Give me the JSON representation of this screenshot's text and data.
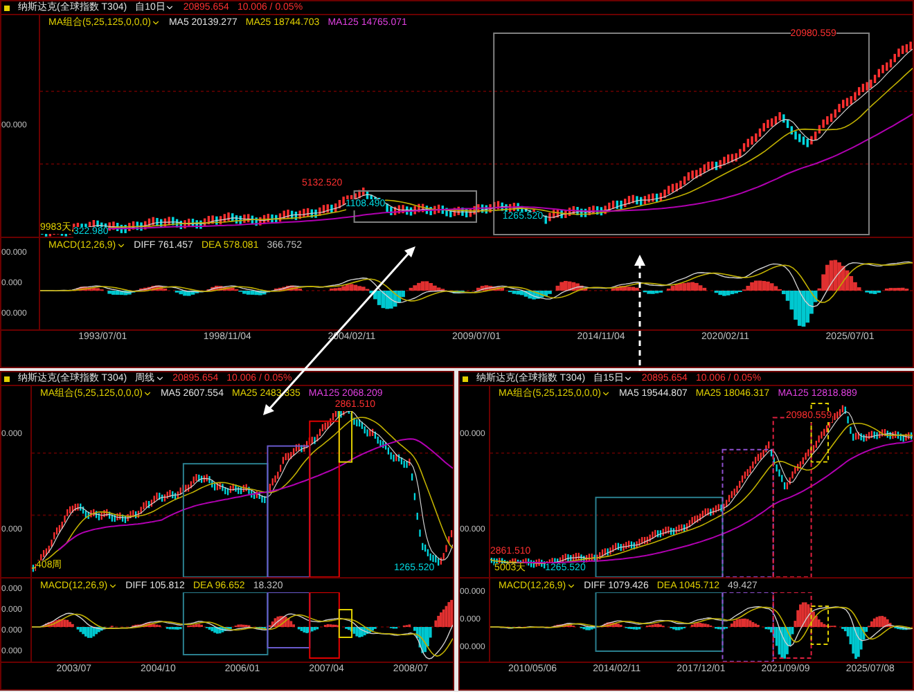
{
  "panels": [
    {
      "title": "纳斯达克(全球指数 T304)",
      "period": "自10日",
      "price": "20895.654",
      "change": "10.006 / 0.05%",
      "ma": {
        "label": "MA组合(5,25,125,0,0,0)",
        "ma5": "MA5 20139.277",
        "ma25": "MA25 18744.703",
        "ma125": "MA125 14765.071"
      },
      "price_ticks": [
        "00.000"
      ],
      "labels": [
        {
          "text": "20980.559",
          "color": "#ff3030"
        },
        {
          "text": "5132.520",
          "color": "#ff3030"
        },
        {
          "text": "1108.490",
          "color": "#00d8e0"
        },
        {
          "text": "1265.520",
          "color": "#00d8e0"
        },
        {
          "text": "9983天",
          "color": "#e0d000"
        },
        {
          "text": "322.980",
          "color": "#00d8e0"
        }
      ],
      "macd": {
        "label": "MACD(12,26,9)",
        "diff": "DIFF 761.457",
        "dea": "DEA 578.081",
        "value": "366.752"
      },
      "macd_ticks": [
        "00.000",
        "0.000",
        "00.000"
      ],
      "dates": [
        "1993/07/01",
        "1998/11/04",
        "2004/02/11",
        "2009/07/01",
        "2014/11/04",
        "2020/02/11",
        "2025/07/01"
      ]
    },
    {
      "title": "纳斯达克(全球指数 T304)",
      "period": "周线",
      "price": "20895.654",
      "change": "10.006 / 0.05%",
      "ma": {
        "label": "MA组合(5,25,125,0,0,0)",
        "ma5": "MA5 2607.554",
        "ma25": "MA25 2483.335",
        "ma125": "MA125 2068.209"
      },
      "price_ticks": [
        "0.000",
        "0.000"
      ],
      "labels": [
        {
          "text": "2861.510",
          "color": "#ff3030"
        },
        {
          "text": "1265.520",
          "color": "#00d8e0"
        },
        {
          "text": "408周",
          "color": "#e0d000"
        }
      ],
      "macd": {
        "label": "MACD(12,26,9)",
        "diff": "DIFF 105.812",
        "dea": "DEA 96.652",
        "value": "18.320"
      },
      "macd_ticks": [
        "0.000",
        "0.000",
        "0.000",
        "0.000"
      ],
      "dates": [
        "2003/07",
        "2004/10",
        "2006/01",
        "2007/04",
        "2008/07"
      ]
    },
    {
      "title": "纳斯达克(全球指数 T304)",
      "period": "自15日",
      "price": "20895.654",
      "change": "10.006 / 0.05%",
      "ma": {
        "label": "MA组合(5,25,125,0,0,0)",
        "ma5": "MA5 19544.807",
        "ma25": "MA25 18046.317",
        "ma125": "MA125 12818.889"
      },
      "price_ticks": [
        "00.000",
        "00.000"
      ],
      "labels": [
        {
          "text": "20980.559",
          "color": "#ff3030"
        },
        {
          "text": "2861.510",
          "color": "#ff3030"
        },
        {
          "text": "5003天",
          "color": "#e0d000"
        },
        {
          "text": "1265.520",
          "color": "#00d8e0"
        }
      ],
      "macd": {
        "label": "MACD(12,26,9)",
        "diff": "DIFF 1079.426",
        "dea": "DEA 1045.712",
        "value": "49.427"
      },
      "macd_ticks": [
        "00.000",
        "0.000",
        "00.000"
      ],
      "dates": [
        "2010/05/06",
        "2014/02/11",
        "2017/12/01",
        "2021/09/09",
        "2025/07/08"
      ]
    }
  ]
}
